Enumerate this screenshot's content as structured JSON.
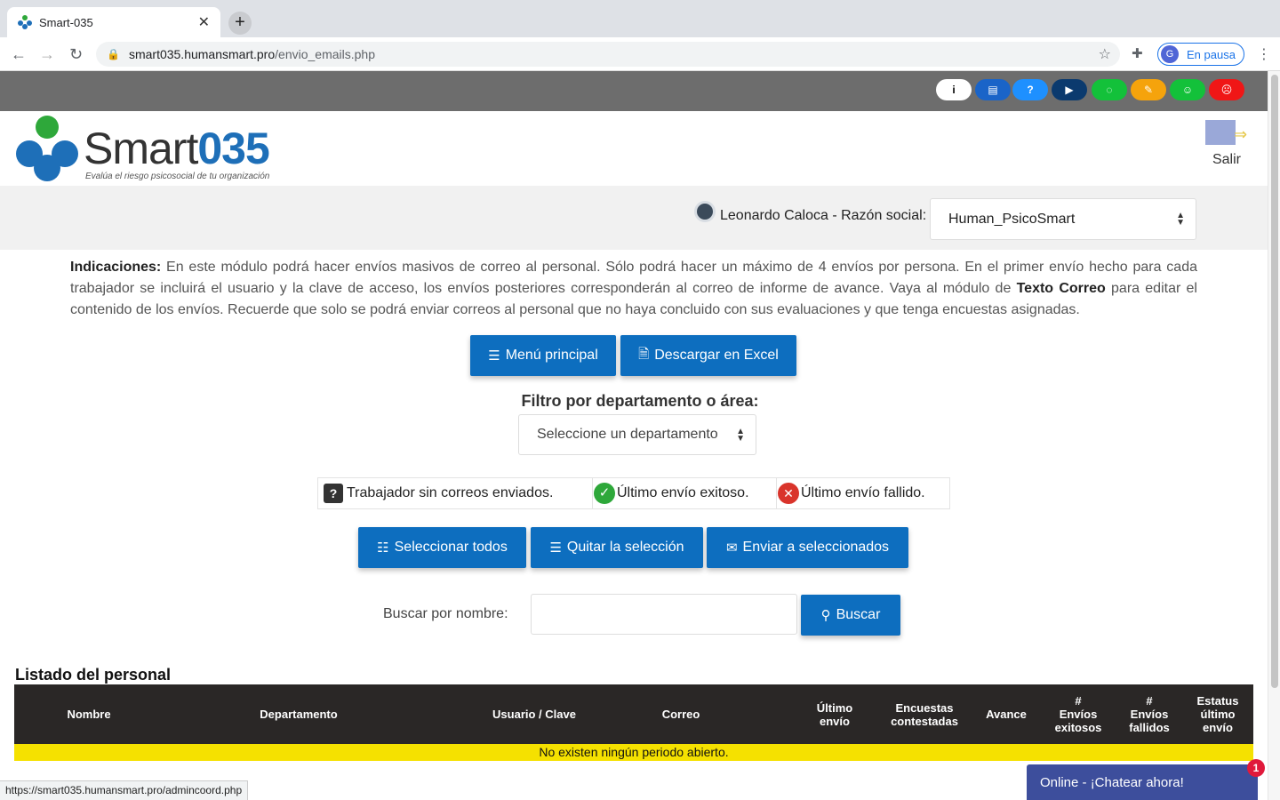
{
  "browser": {
    "tab_title": "Smart-035",
    "tab_close": "✕",
    "new_tab": "+",
    "url_host": "smart035.humansmart.pro",
    "url_path": "/envio_emails.php",
    "profile_initial": "G",
    "profile_label": "En pausa",
    "status_url": "https://smart035.humansmart.pro/admincoord.php"
  },
  "social_icons": [
    {
      "name": "info-icon",
      "glyph": "i",
      "color": "#ffffff",
      "fg": "#000000"
    },
    {
      "name": "document-icon",
      "glyph": "▤",
      "color": "#1a64c8",
      "fg": "#ffffff"
    },
    {
      "name": "help-icon",
      "glyph": "?",
      "color": "#1e90ff",
      "fg": "#ffffff"
    },
    {
      "name": "youtube-icon",
      "glyph": "▶",
      "color": "#0b3a6e",
      "fg": "#ffffff"
    },
    {
      "name": "chat-icon",
      "glyph": "◌",
      "color": "#13c13a",
      "fg": "#ffffff"
    },
    {
      "name": "note-icon",
      "glyph": "✎",
      "color": "#f5a30c",
      "fg": "#ffffff"
    },
    {
      "name": "smile-icon",
      "glyph": "☺",
      "color": "#13c13a",
      "fg": "#ffffff"
    },
    {
      "name": "sad-icon",
      "glyph": "☹",
      "color": "#f01616",
      "fg": "#ffffff"
    }
  ],
  "logo": {
    "brand_pre": "Smart",
    "brand_num": "035",
    "tagline": "Evalúa el riesgo psicosocial de tu organización"
  },
  "header": {
    "logout_label": "Salir"
  },
  "userbar": {
    "user_text": "Leonardo Caloca - Razón social:",
    "company_selected": "Human_PsicoSmart"
  },
  "indications": {
    "label": "Indicaciones:",
    "text_1": " En este módulo podrá hacer envíos masivos de correo al personal. Sólo podrá hacer un máximo de 4 envíos por persona. En el primer envío hecho para cada trabajador se incluirá el usuario y la clave de acceso, los envíos posteriores corresponderán al correo de informe de avance. Vaya al módulo de ",
    "bold": "Texto Correo",
    "text_2": " para editar el contenido de los envíos. Recuerde que solo se podrá enviar correos al personal que no haya concluido con sus evaluaciones y que tenga encuestas asignadas."
  },
  "actions": {
    "menu_label": "Menú principal",
    "excel_label": "Descargar en Excel"
  },
  "filter": {
    "label": "Filtro por departamento o área:",
    "selected": "Seleccione un departamento"
  },
  "legend": {
    "no_mail": "Trabajador sin correos enviados.",
    "success": "Último envío exitoso.",
    "failed": "Último envío fallido."
  },
  "selection": {
    "select_all": "Seleccionar todos",
    "clear": "Quitar la selección",
    "send": "Enviar a seleccionados"
  },
  "search": {
    "label": "Buscar por nombre:",
    "value": "",
    "button": "Buscar"
  },
  "table": {
    "title": "Listado del personal",
    "columns": [
      "Nombre",
      "Departamento",
      "Usuario / Clave",
      "Correo",
      "Último\nenvío",
      "Encuestas\ncontestadas",
      "Avance",
      "#\nEnvíos\nexitosos",
      "#\nEnvíos\nfallidos",
      "Estatus\núltimo\nenvío"
    ],
    "empty_message": "No existen ningún periodo abierto."
  },
  "chat": {
    "label": "Online - ¡Chatear ahora!",
    "badge": "1"
  }
}
